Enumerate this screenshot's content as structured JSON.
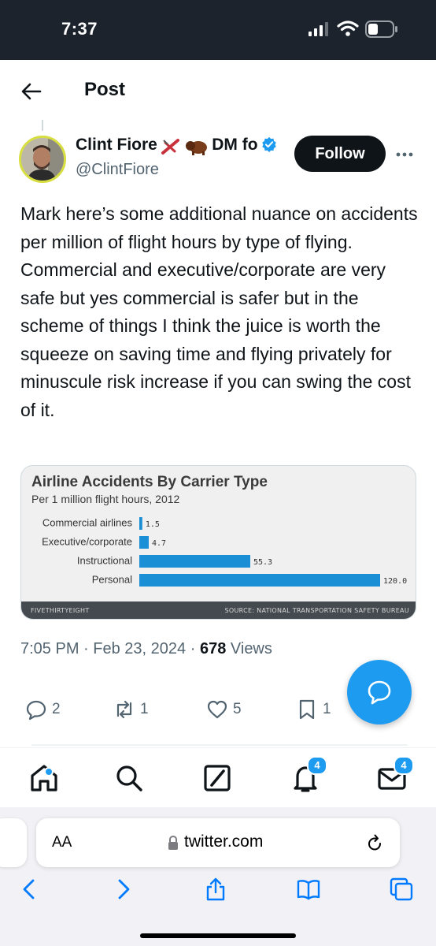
{
  "status_bar": {
    "time": "7:37"
  },
  "header": {
    "title": "Post"
  },
  "author": {
    "name": "Clint Fiore",
    "name_suffix": "DM fo",
    "handle": "@ClintFiore",
    "verified_color": "#1d9bf0"
  },
  "follow_label": "Follow",
  "post_text": "Mark here’s some additional nuance on accidents per million of flight hours by type of flying. Commercial and executive/corporate are very safe but yes commercial is safer but in the scheme of things I think the juice is worth the squeeze on saving time and flying privately for minuscule risk increase if you can swing the cost of it.",
  "chart_data": {
    "type": "bar",
    "orientation": "horizontal",
    "title": "Airline Accidents By Carrier Type",
    "subtitle": "Per 1 million flight hours, 2012",
    "categories": [
      "Commercial airlines",
      "Executive/corporate",
      "Instructional",
      "Personal"
    ],
    "values": [
      1.5,
      4.7,
      55.3,
      120.0
    ],
    "value_labels": [
      "1.5",
      "4.7",
      "55.3",
      "120.0"
    ],
    "bar_color": "#1a8fd6",
    "footer_logo": "FIVETHIRTYEIGHT",
    "source": "SOURCE: NATIONAL TRANSPORTATION SAFETY BUREAU"
  },
  "meta": {
    "time": "7:05 PM",
    "separator": "·",
    "date": "Feb 23, 2024",
    "views_count": "678",
    "views_label": "Views"
  },
  "actions": {
    "replies": "2",
    "reposts": "1",
    "likes": "5",
    "bookmarks": "1"
  },
  "tabbar": {
    "notifications_badge": "4",
    "messages_badge": "4"
  },
  "browser": {
    "aa_label": "AA",
    "url": "twitter.com"
  },
  "colors": {
    "accent": "#1d9bf0",
    "status_bar_bg": "#1c232d",
    "ios_blue": "#007aff"
  }
}
